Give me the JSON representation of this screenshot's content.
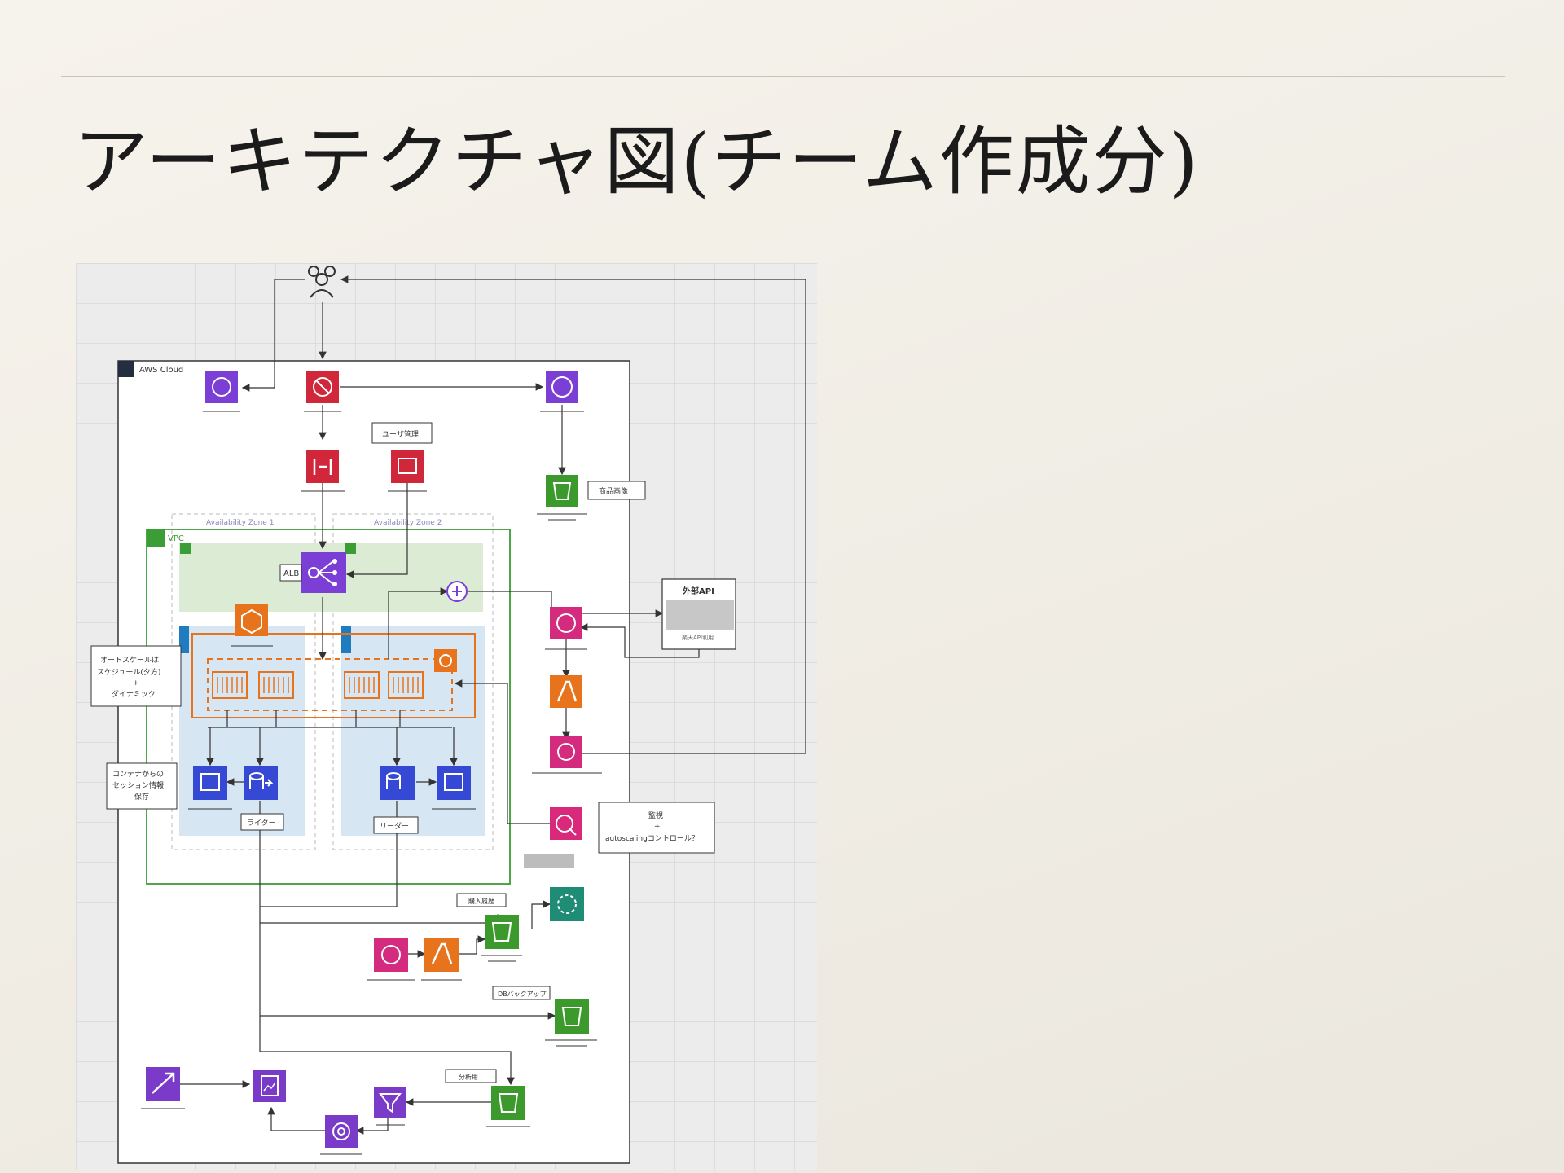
{
  "title": "アーキテクチャ図(チーム作成分)",
  "diagram": {
    "cloud_label": "AWS Cloud",
    "vpc_label": "VPC",
    "az1_label": "Availability Zone 1",
    "az2_label": "Availability Zone 2",
    "alb_label": "ALB",
    "user_mgmt_label": "ユーザ管理",
    "product_image_label": "商品画像",
    "external_api_label": "外部API",
    "external_api_sub": "楽天API利用",
    "autoscale_note": [
      "オートスケールは",
      "スケジュール(夕方)",
      "+",
      "ダイナミック"
    ],
    "session_note": [
      "コンテナからの",
      "セッション情報",
      "保存"
    ],
    "writer_label": "ライター",
    "reader_label": "リーダー",
    "monitoring_note": [
      "監視",
      "+",
      "autoscalingコントロール？"
    ],
    "purchase_history_label": "購入履歴",
    "db_backup_label": "DBバックアップ",
    "analysis_label": "分析用"
  },
  "colors": {
    "security_red": "#d0283a",
    "network_purple": "#7c3fd6",
    "storage_green": "#3c9a2c",
    "compute_orange": "#e7731c",
    "database_blue": "#3649d4",
    "integration_pink": "#d42b7e",
    "management_pink": "#d9297a",
    "analytics_purple": "#7a3bc9",
    "ml_teal": "#1f8c76",
    "vpc_green": "#3a9d35",
    "subnet_public": "#dcebd3",
    "subnet_private": "#d6e6f2"
  },
  "icons": [
    "users-icon",
    "cognito-icon",
    "waf-icon",
    "cloudfront-icon",
    "api-gateway-icon",
    "secrets-icon",
    "s3-icon",
    "alb-icon",
    "ecs-icon",
    "fargate-task-icon",
    "eventbridge-icon",
    "lambda-icon",
    "sns-icon",
    "elasticache-icon",
    "rds-icon",
    "cloudwatch-icon",
    "sagemaker-icon",
    "glue-icon",
    "athena-icon",
    "quicksight-icon",
    "kinesis-icon"
  ]
}
